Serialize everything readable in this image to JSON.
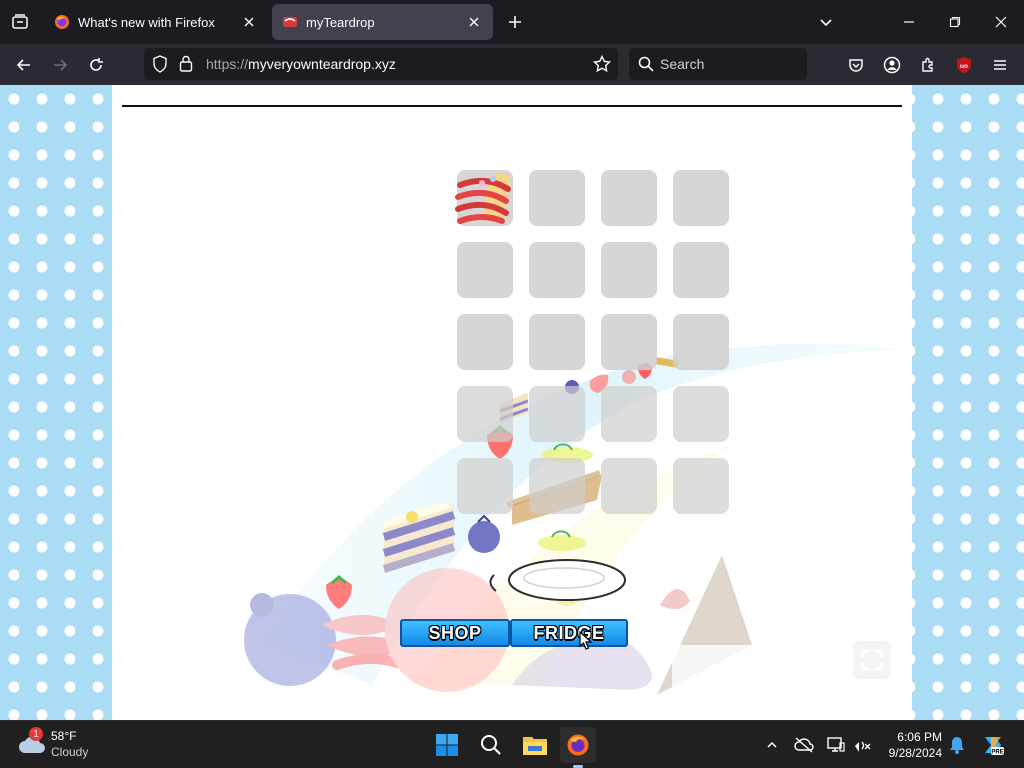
{
  "browser": {
    "tabs": [
      {
        "title": "What's new with Firefox",
        "active": false
      },
      {
        "title": "myTeardrop",
        "active": true
      }
    ],
    "url_proto": "https://",
    "url_host": "myveryownteardrop.xyz",
    "search_placeholder": "Search",
    "addon_badge": "uo"
  },
  "game": {
    "buttons": {
      "shop": "SHOP",
      "fridge": "FRIDGE"
    },
    "grid_rows": 5,
    "grid_cols": 4
  },
  "taskbar": {
    "weather_temp": "58°F",
    "weather_cond": "Cloudy",
    "weather_badge": "1",
    "time": "6:06 PM",
    "date": "9/28/2024"
  },
  "colors": {
    "accent": "#1689e8",
    "wallpaper": "#aadcf5"
  }
}
